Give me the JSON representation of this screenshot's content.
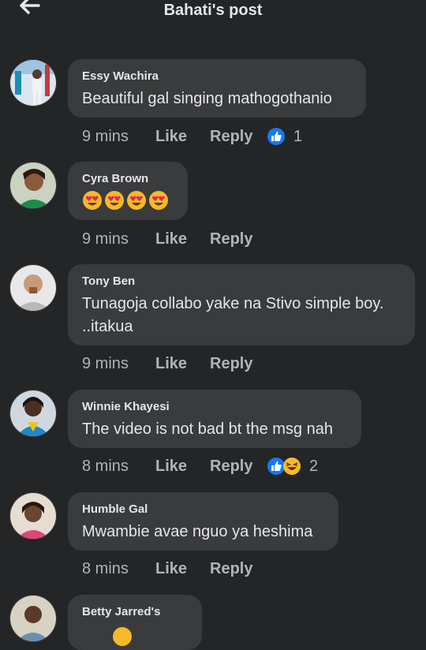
{
  "header": {
    "title": "Bahati's post"
  },
  "comments": [
    {
      "author": "Essy Wachira",
      "text": "Beautiful gal singing mathogothanio",
      "time": "9 mins",
      "like": "Like",
      "reply": "Reply",
      "reaction_count": "1",
      "reactions": [
        "like"
      ]
    },
    {
      "author": "Cyra Brown",
      "text": "",
      "emojis": [
        "heart-eyes",
        "heart-eyes",
        "heart-eyes",
        "heart-eyes"
      ],
      "time": "9 mins",
      "like": "Like",
      "reply": "Reply"
    },
    {
      "author": "Tony Ben",
      "text_lines": [
        "Tunagoja collabo yake na Stivo simple boy.",
        "..itakua"
      ],
      "time": "9 mins",
      "like": "Like",
      "reply": "Reply"
    },
    {
      "author": "Winnie Khayesi",
      "text": "The video is not bad bt the msg nah",
      "time": "8 mins",
      "like": "Like",
      "reply": "Reply",
      "reaction_count": "2",
      "reactions": [
        "like",
        "haha"
      ]
    },
    {
      "author": "Humble Gal",
      "text": "Mwambie avae nguo ya heshima",
      "time": "8 mins",
      "like": "Like",
      "reply": "Reply"
    },
    {
      "author": "Betty Jarred's",
      "text": ""
    }
  ],
  "colors": {
    "background": "#242526",
    "bubble": "#3a3b3c",
    "like_blue": "#1877f2",
    "haha_yellow": "#f7b928"
  }
}
